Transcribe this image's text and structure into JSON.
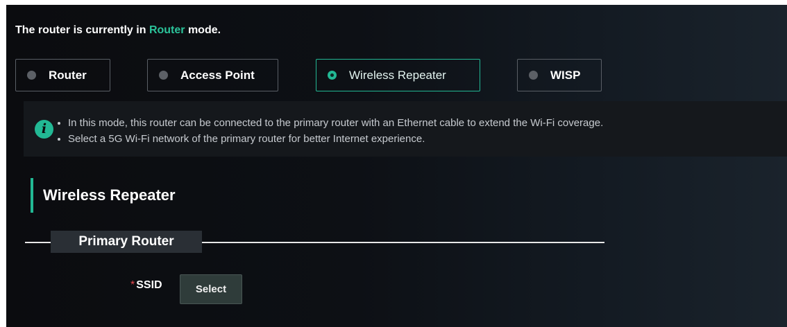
{
  "status": {
    "prefix": "The router is currently in ",
    "mode": "Router",
    "suffix": " mode."
  },
  "modes": [
    {
      "label": "Router",
      "selected": false
    },
    {
      "label": "Access Point",
      "selected": false
    },
    {
      "label": "Wireless Repeater",
      "selected": true
    },
    {
      "label": "WISP",
      "selected": false
    }
  ],
  "info": {
    "icon": "info-icon",
    "lines": [
      "In this mode, this router can be connected to the primary router with an Ethernet cable to extend the Wi-Fi coverage.",
      "Select a 5G Wi-Fi network of the primary router for better Internet experience."
    ]
  },
  "section": {
    "title": "Wireless Repeater"
  },
  "subsection": {
    "title": "Primary Router"
  },
  "ssid": {
    "required_mark": "*",
    "label": "SSID",
    "button": "Select"
  },
  "colors": {
    "accent": "#22b894",
    "background": "#0d1015",
    "required": "#e5484d"
  }
}
